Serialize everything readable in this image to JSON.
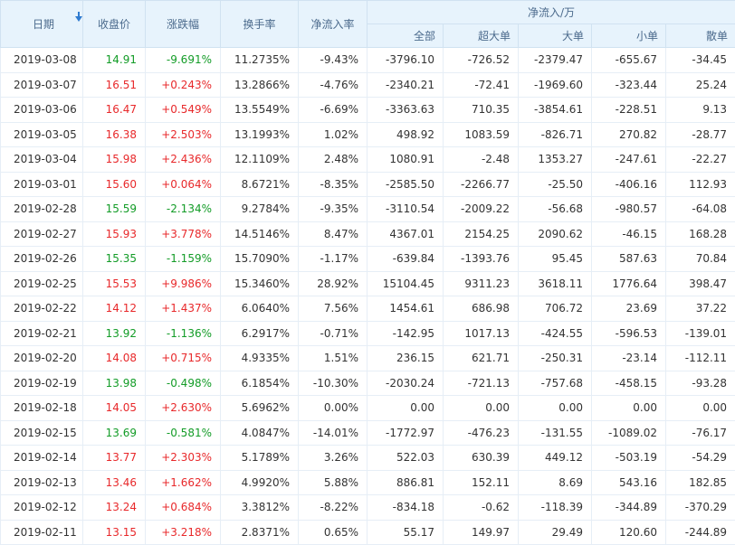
{
  "header": {
    "date": "日期",
    "close": "收盘价",
    "change": "涨跌幅",
    "turnover": "换手率",
    "net_rate": "净流入率",
    "net_flow": "净流入/万",
    "all": "全部",
    "xl": "超大单",
    "large": "大单",
    "medium": "小单",
    "small": "散单"
  },
  "colors": {
    "up": "#e8292b",
    "down": "#139c27",
    "header_bg": "#e7f3fc"
  },
  "rows": [
    {
      "date": "2019-03-08",
      "close": "14.91",
      "change": "-9.691%",
      "turnover": "11.2735%",
      "rate": "-9.43%",
      "all": "-3796.10",
      "xl": "-726.52",
      "large": "-2379.47",
      "medium": "-655.67",
      "small": "-34.45",
      "dir": "down"
    },
    {
      "date": "2019-03-07",
      "close": "16.51",
      "change": "+0.243%",
      "turnover": "13.2866%",
      "rate": "-4.76%",
      "all": "-2340.21",
      "xl": "-72.41",
      "large": "-1969.60",
      "medium": "-323.44",
      "small": "25.24",
      "dir": "up"
    },
    {
      "date": "2019-03-06",
      "close": "16.47",
      "change": "+0.549%",
      "turnover": "13.5549%",
      "rate": "-6.69%",
      "all": "-3363.63",
      "xl": "710.35",
      "large": "-3854.61",
      "medium": "-228.51",
      "small": "9.13",
      "dir": "up"
    },
    {
      "date": "2019-03-05",
      "close": "16.38",
      "change": "+2.503%",
      "turnover": "13.1993%",
      "rate": "1.02%",
      "all": "498.92",
      "xl": "1083.59",
      "large": "-826.71",
      "medium": "270.82",
      "small": "-28.77",
      "dir": "up"
    },
    {
      "date": "2019-03-04",
      "close": "15.98",
      "change": "+2.436%",
      "turnover": "12.1109%",
      "rate": "2.48%",
      "all": "1080.91",
      "xl": "-2.48",
      "large": "1353.27",
      "medium": "-247.61",
      "small": "-22.27",
      "dir": "up"
    },
    {
      "date": "2019-03-01",
      "close": "15.60",
      "change": "+0.064%",
      "turnover": "8.6721%",
      "rate": "-8.35%",
      "all": "-2585.50",
      "xl": "-2266.77",
      "large": "-25.50",
      "medium": "-406.16",
      "small": "112.93",
      "dir": "up"
    },
    {
      "date": "2019-02-28",
      "close": "15.59",
      "change": "-2.134%",
      "turnover": "9.2784%",
      "rate": "-9.35%",
      "all": "-3110.54",
      "xl": "-2009.22",
      "large": "-56.68",
      "medium": "-980.57",
      "small": "-64.08",
      "dir": "down"
    },
    {
      "date": "2019-02-27",
      "close": "15.93",
      "change": "+3.778%",
      "turnover": "14.5146%",
      "rate": "8.47%",
      "all": "4367.01",
      "xl": "2154.25",
      "large": "2090.62",
      "medium": "-46.15",
      "small": "168.28",
      "dir": "up"
    },
    {
      "date": "2019-02-26",
      "close": "15.35",
      "change": "-1.159%",
      "turnover": "15.7090%",
      "rate": "-1.17%",
      "all": "-639.84",
      "xl": "-1393.76",
      "large": "95.45",
      "medium": "587.63",
      "small": "70.84",
      "dir": "down"
    },
    {
      "date": "2019-02-25",
      "close": "15.53",
      "change": "+9.986%",
      "turnover": "15.3460%",
      "rate": "28.92%",
      "all": "15104.45",
      "xl": "9311.23",
      "large": "3618.11",
      "medium": "1776.64",
      "small": "398.47",
      "dir": "up"
    },
    {
      "date": "2019-02-22",
      "close": "14.12",
      "change": "+1.437%",
      "turnover": "6.0640%",
      "rate": "7.56%",
      "all": "1454.61",
      "xl": "686.98",
      "large": "706.72",
      "medium": "23.69",
      "small": "37.22",
      "dir": "up"
    },
    {
      "date": "2019-02-21",
      "close": "13.92",
      "change": "-1.136%",
      "turnover": "6.2917%",
      "rate": "-0.71%",
      "all": "-142.95",
      "xl": "1017.13",
      "large": "-424.55",
      "medium": "-596.53",
      "small": "-139.01",
      "dir": "down"
    },
    {
      "date": "2019-02-20",
      "close": "14.08",
      "change": "+0.715%",
      "turnover": "4.9335%",
      "rate": "1.51%",
      "all": "236.15",
      "xl": "621.71",
      "large": "-250.31",
      "medium": "-23.14",
      "small": "-112.11",
      "dir": "up"
    },
    {
      "date": "2019-02-19",
      "close": "13.98",
      "change": "-0.498%",
      "turnover": "6.1854%",
      "rate": "-10.30%",
      "all": "-2030.24",
      "xl": "-721.13",
      "large": "-757.68",
      "medium": "-458.15",
      "small": "-93.28",
      "dir": "down"
    },
    {
      "date": "2019-02-18",
      "close": "14.05",
      "change": "+2.630%",
      "turnover": "5.6962%",
      "rate": "0.00%",
      "all": "0.00",
      "xl": "0.00",
      "large": "0.00",
      "medium": "0.00",
      "small": "0.00",
      "dir": "up"
    },
    {
      "date": "2019-02-15",
      "close": "13.69",
      "change": "-0.581%",
      "turnover": "4.0847%",
      "rate": "-14.01%",
      "all": "-1772.97",
      "xl": "-476.23",
      "large": "-131.55",
      "medium": "-1089.02",
      "small": "-76.17",
      "dir": "down"
    },
    {
      "date": "2019-02-14",
      "close": "13.77",
      "change": "+2.303%",
      "turnover": "5.1789%",
      "rate": "3.26%",
      "all": "522.03",
      "xl": "630.39",
      "large": "449.12",
      "medium": "-503.19",
      "small": "-54.29",
      "dir": "up"
    },
    {
      "date": "2019-02-13",
      "close": "13.46",
      "change": "+1.662%",
      "turnover": "4.9920%",
      "rate": "5.88%",
      "all": "886.81",
      "xl": "152.11",
      "large": "8.69",
      "medium": "543.16",
      "small": "182.85",
      "dir": "up"
    },
    {
      "date": "2019-02-12",
      "close": "13.24",
      "change": "+0.684%",
      "turnover": "3.3812%",
      "rate": "-8.22%",
      "all": "-834.18",
      "xl": "-0.62",
      "large": "-118.39",
      "medium": "-344.89",
      "small": "-370.29",
      "dir": "up"
    },
    {
      "date": "2019-02-11",
      "close": "13.15",
      "change": "+3.218%",
      "turnover": "2.8371%",
      "rate": "0.65%",
      "all": "55.17",
      "xl": "149.97",
      "large": "29.49",
      "medium": "120.60",
      "small": "-244.89",
      "dir": "up"
    }
  ]
}
